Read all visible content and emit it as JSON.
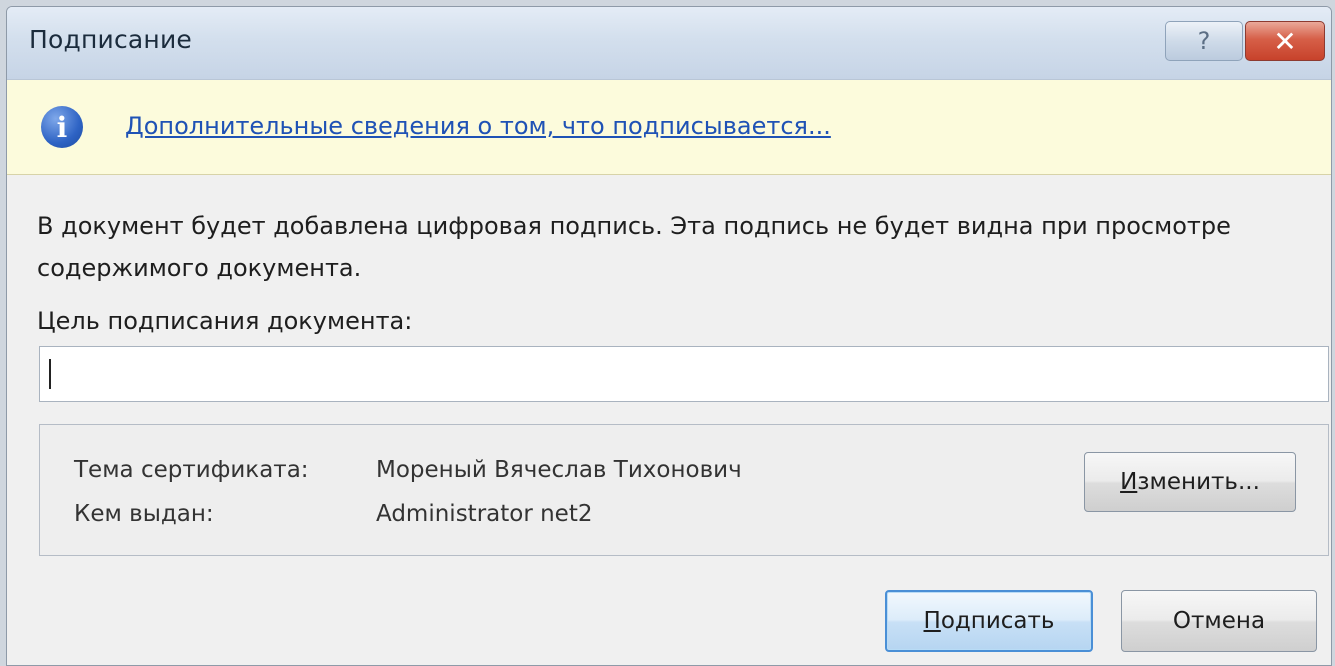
{
  "window": {
    "title": "Подписание",
    "help_glyph": "?",
    "close_glyph": "✕"
  },
  "infobar": {
    "icon": "info-icon",
    "icon_glyph": "i",
    "link_text": "Дополнительные сведения о том, что подписывается..."
  },
  "body": {
    "description": "В документ будет добавлена цифровая подпись. Эта подпись не будет видна при просмотре содержимого документа.",
    "purpose_label": "Цель подписания документа:",
    "purpose_value": ""
  },
  "certificate": {
    "subject_label": "Тема сертификата:",
    "subject_value": "Мореный Вячеслав Тихонович",
    "issuer_label": "Кем выдан:",
    "issuer_value": "Administrator net2",
    "change_button_first": "И",
    "change_button_rest": "зменить..."
  },
  "buttons": {
    "sign_first": "П",
    "sign_rest": "одписать",
    "cancel": "Отмена"
  },
  "colors": {
    "infobar_bg": "#fcfbdc",
    "link": "#1f52b5",
    "close_red": "#c7422b",
    "default_button_border": "#4a8fd6"
  }
}
